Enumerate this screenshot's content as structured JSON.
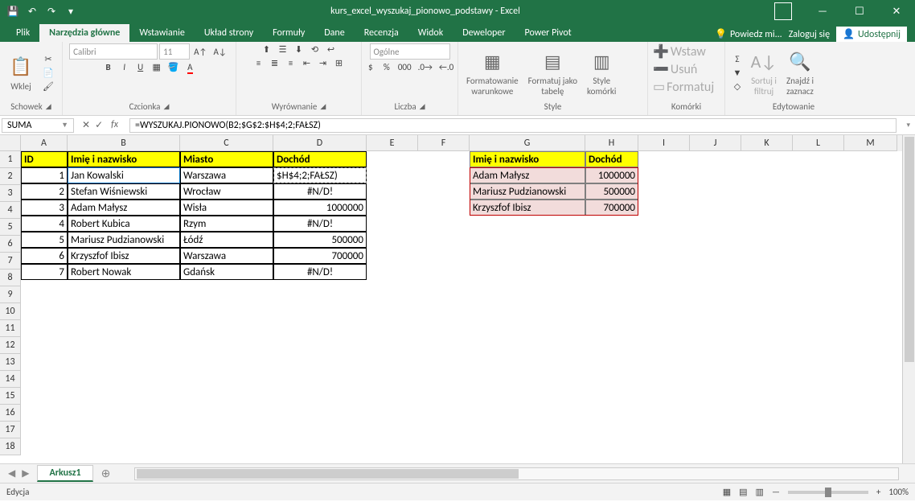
{
  "title": "kurs_excel_wyszukaj_pionowo_podstawy - Excel",
  "tabs": {
    "file": "Plik",
    "home": "Narzędzia główne",
    "insert": "Wstawianie",
    "page_layout": "Układ strony",
    "formulas": "Formuły",
    "data": "Dane",
    "review": "Recenzja",
    "view": "Widok",
    "developer": "Deweloper",
    "power_pivot": "Power Pivot",
    "tell_me": "Powiedz mi...",
    "sign_in": "Zaloguj się",
    "share": "Udostępnij"
  },
  "ribbon": {
    "clipboard": {
      "label": "Schowek",
      "paste": "Wklej"
    },
    "font": {
      "label": "Czcionka",
      "family": "Calibri",
      "size": "11"
    },
    "alignment": {
      "label": "Wyrównanie"
    },
    "number": {
      "label": "Liczba",
      "format": "Ogólne"
    },
    "styles": {
      "label": "Style",
      "cond_fmt": "Formatowanie\nwarunkowe",
      "fmt_table": "Formatuj jako\ntabelę",
      "cell_styles": "Style\nkomórki"
    },
    "cells": {
      "label": "Komórki",
      "insert": "Wstaw",
      "delete": "Usuń",
      "format": "Formatuj"
    },
    "editing": {
      "label": "Edytowanie",
      "sort": "Sortuj i\nfiltruj",
      "find": "Znajdź i\nzaznacz"
    }
  },
  "name_box": "SUMA",
  "formula": "=WYSZUKAJ.PIONOWO(B2;$G$2:$H$4;2;FAŁSZ)",
  "columns": [
    "A",
    "B",
    "C",
    "D",
    "E",
    "F",
    "G",
    "H",
    "I",
    "J",
    "K",
    "L",
    "M"
  ],
  "headers": {
    "A1": "ID",
    "B1": "Imię i nazwisko",
    "C1": "Miasto",
    "D1": "Dochód",
    "G1": "Imię i nazwisko",
    "H1": "Dochód"
  },
  "table1": [
    {
      "id": "1",
      "name": "Jan Kowalski",
      "city": "Warszawa",
      "income": "$H$4;2;FAŁSZ)"
    },
    {
      "id": "2",
      "name": "Stefan Wiśniewski",
      "city": "Wrocław",
      "income": "#N/D!"
    },
    {
      "id": "3",
      "name": "Adam Małysz",
      "city": "Wisła",
      "income": "1000000"
    },
    {
      "id": "4",
      "name": "Robert Kubica",
      "city": "Rzym",
      "income": "#N/D!"
    },
    {
      "id": "5",
      "name": "Mariusz Pudzianowski",
      "city": "Łódź",
      "income": "500000"
    },
    {
      "id": "6",
      "name": "Krzyszfof Ibisz",
      "city": "Warszawa",
      "income": "700000"
    },
    {
      "id": "7",
      "name": "Robert Nowak",
      "city": "Gdańsk",
      "income": "#N/D!"
    }
  ],
  "table2": [
    {
      "name": "Adam Małysz",
      "income": "1000000"
    },
    {
      "name": "Mariusz Pudzianowski",
      "income": "500000"
    },
    {
      "name": "Krzyszfof Ibisz",
      "income": "700000"
    }
  ],
  "income_align": [
    "left",
    "center",
    "right",
    "center",
    "right",
    "right",
    "center"
  ],
  "sheet_tab": "Arkusz1",
  "status": "Edycja",
  "zoom": "100%"
}
